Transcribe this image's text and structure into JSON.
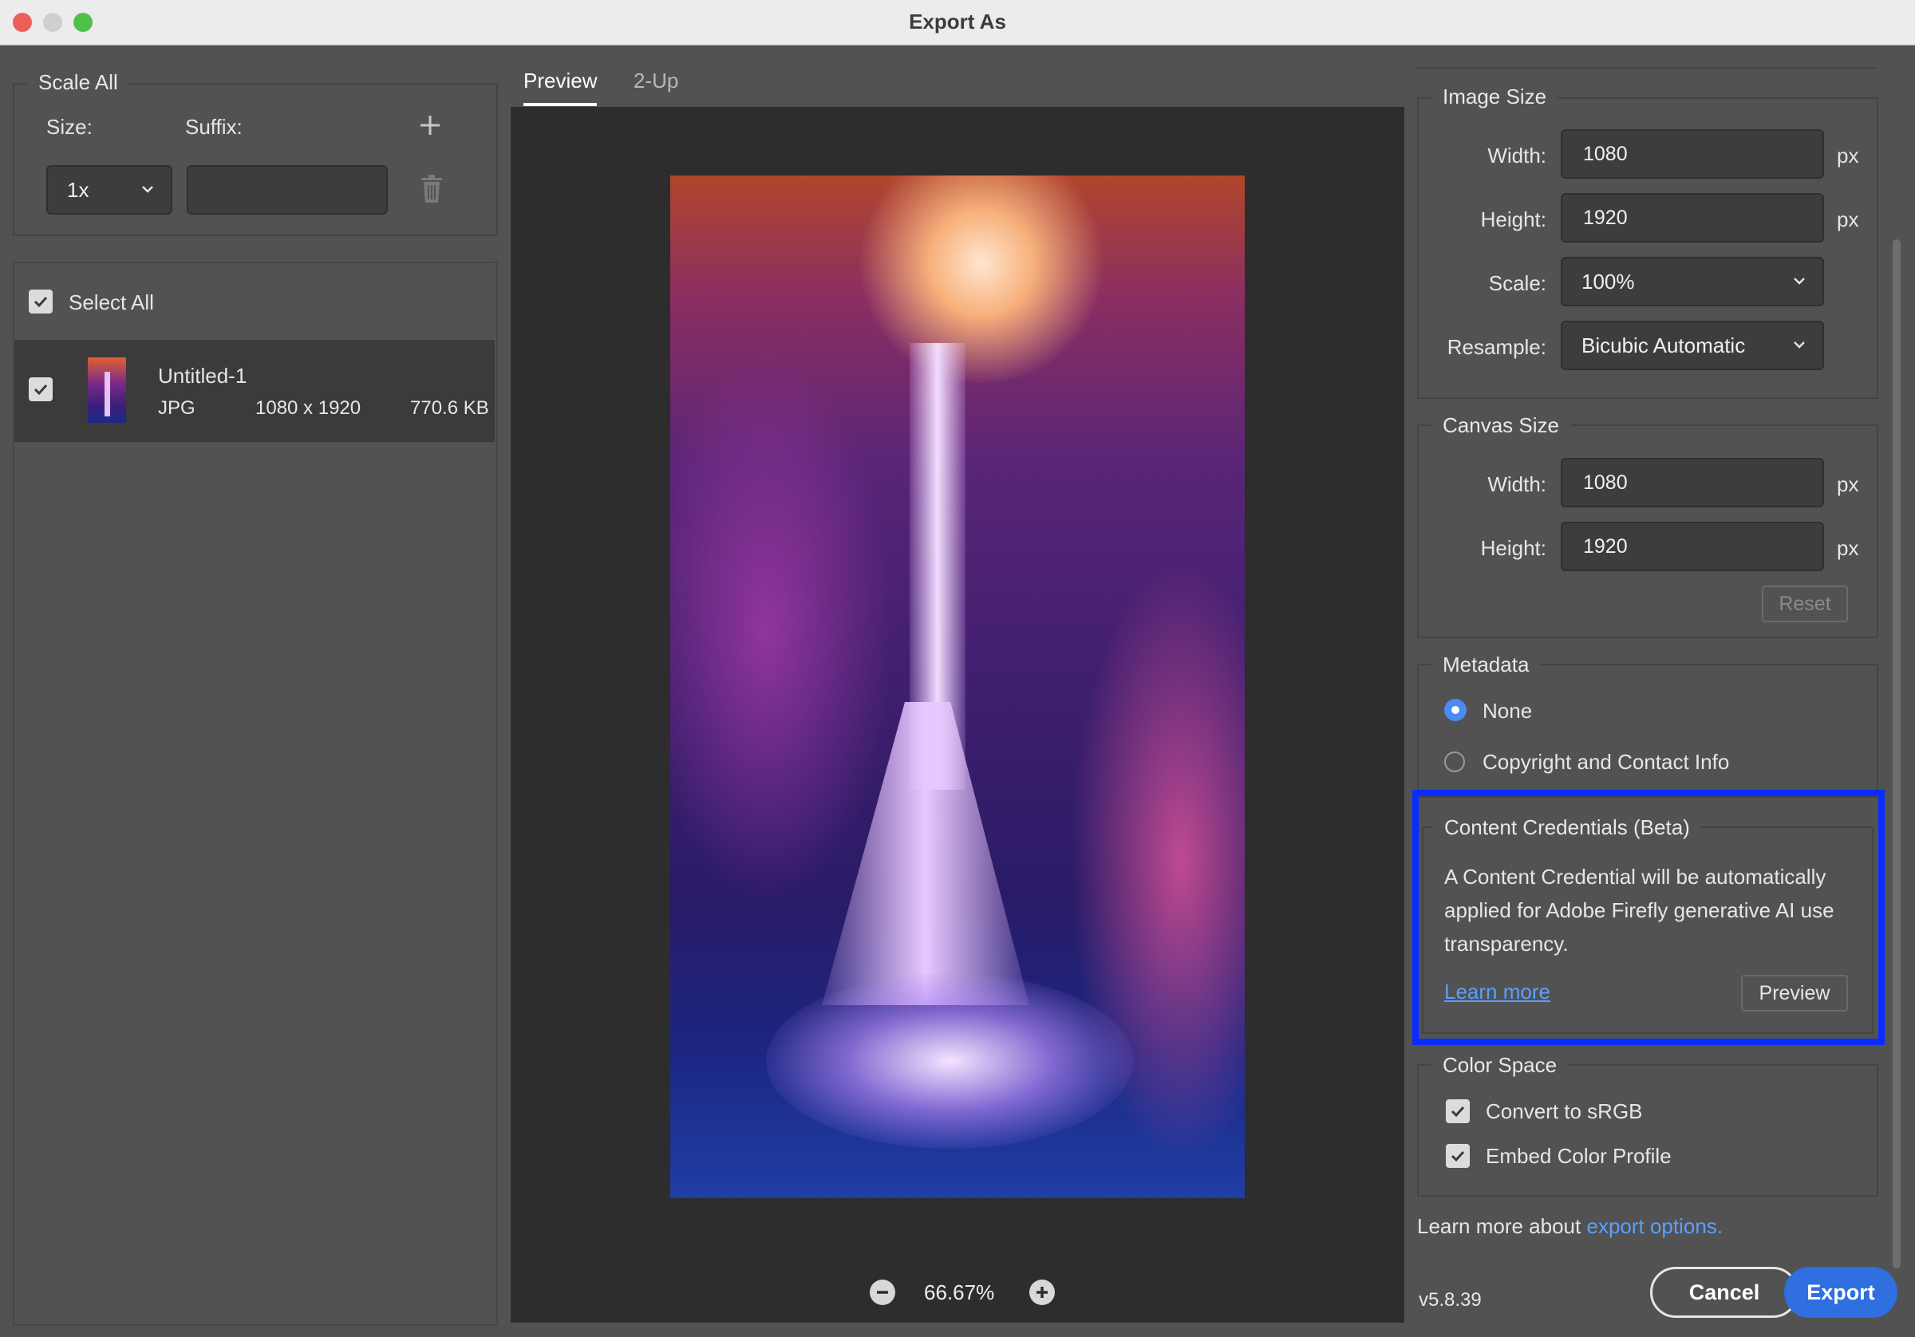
{
  "window": {
    "title": "Export As"
  },
  "colors": {
    "accent": "#2f6fe0",
    "highlight_box": "#0a2cff",
    "link": "#5aa0ff"
  },
  "scale_all": {
    "legend": "Scale All",
    "size_label": "Size:",
    "suffix_label": "Suffix:",
    "size_value": "1x",
    "suffix_value": "",
    "add_icon": "plus-icon",
    "delete_icon": "trash-icon"
  },
  "file_list": {
    "select_all_label": "Select All",
    "select_all_checked": true,
    "items": [
      {
        "name": "Untitled-1",
        "format": "JPG",
        "dimensions": "1080 x 1920",
        "size": "770.6 KB",
        "checked": true
      }
    ]
  },
  "preview": {
    "tabs": [
      {
        "label": "Preview",
        "active": true
      },
      {
        "label": "2-Up",
        "active": false
      }
    ],
    "zoom": "66.67%"
  },
  "image_size": {
    "legend": "Image Size",
    "width_label": "Width:",
    "width_value": "1080",
    "height_label": "Height:",
    "height_value": "1920",
    "scale_label": "Scale:",
    "scale_value": "100%",
    "resample_label": "Resample:",
    "resample_value": "Bicubic Automatic",
    "unit": "px"
  },
  "canvas_size": {
    "legend": "Canvas Size",
    "width_label": "Width:",
    "width_value": "1080",
    "height_label": "Height:",
    "height_value": "1920",
    "unit": "px",
    "reset_label": "Reset"
  },
  "metadata": {
    "legend": "Metadata",
    "options": [
      {
        "label": "None",
        "selected": true
      },
      {
        "label": "Copyright and Contact Info",
        "selected": false
      }
    ]
  },
  "content_credentials": {
    "legend": "Content Credentials (Beta)",
    "description_lines": [
      "A Content Credential will be automatically",
      "applied for Adobe Firefly generative AI use",
      "transparency."
    ],
    "learn_more": "Learn more",
    "preview_button": "Preview"
  },
  "color_space": {
    "legend": "Color Space",
    "options": [
      {
        "label": "Convert to sRGB",
        "checked": true
      },
      {
        "label": "Embed Color Profile",
        "checked": true
      }
    ]
  },
  "footer": {
    "learn_more_prefix": "Learn more about",
    "learn_more_link": "export options.",
    "version": "v5.8.39",
    "cancel_label": "Cancel",
    "export_label": "Export"
  }
}
